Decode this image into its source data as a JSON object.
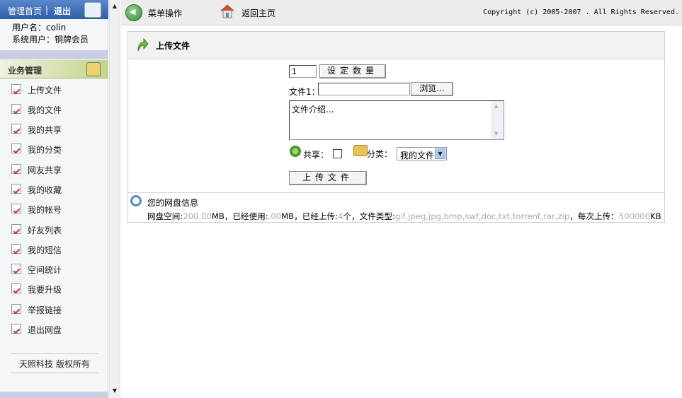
{
  "sidebar": {
    "home_link": "管理首页",
    "separator": "|",
    "logout_link": "退出",
    "user_label": "用户名：colin",
    "role_label": "系统用户：铜牌会员",
    "section_title": "业务管理",
    "items": [
      {
        "label": "上传文件"
      },
      {
        "label": "我的文件"
      },
      {
        "label": "我的共享"
      },
      {
        "label": "我的分类"
      },
      {
        "label": "网友共享"
      },
      {
        "label": "我的收藏"
      },
      {
        "label": "我的帐号"
      },
      {
        "label": "好友列表"
      },
      {
        "label": "我的短信"
      },
      {
        "label": "空间统计"
      },
      {
        "label": "我要升级"
      },
      {
        "label": "举报链接"
      },
      {
        "label": "退出网盘"
      }
    ],
    "copyright": "天照科技 版权所有"
  },
  "toolbar": {
    "menu_label": "菜单操作",
    "home_label": "返回主页",
    "copyright": "Copyright (c) 2005-2007 . All Rights Reserved."
  },
  "upload": {
    "title": "上传文件",
    "quantity_value": "1",
    "set_quantity_button": "设定数量",
    "file_label": "文件1：",
    "file_value": "",
    "browse_button": "浏览...",
    "description_value": "文件介绍...",
    "share_label": "共享：",
    "share_checked": false,
    "category_label": "分类：",
    "category_value": "我的文件",
    "upload_button": "上传文件"
  },
  "disk_info": {
    "title": "您的网盘信息",
    "space_label": "网盘空间:",
    "space_value": "200.00",
    "space_unit": "MB，已经使用:",
    "used_value": ".00",
    "used_unit": "MB，已经上传:",
    "uploaded_value": "4",
    "uploaded_unit": "个，文件类型:",
    "file_types": "gif,jpeg,jpg,bmp,swf,doc,txt,torrent,rar,zip",
    "per_upload_label": "，每次上传：",
    "per_upload_value": "500000",
    "per_upload_unit": "KB"
  },
  "colors": {
    "header_blue": "#2f5ea8",
    "section_green": "#c2d48a",
    "muted_value": "#a9a9a9"
  }
}
